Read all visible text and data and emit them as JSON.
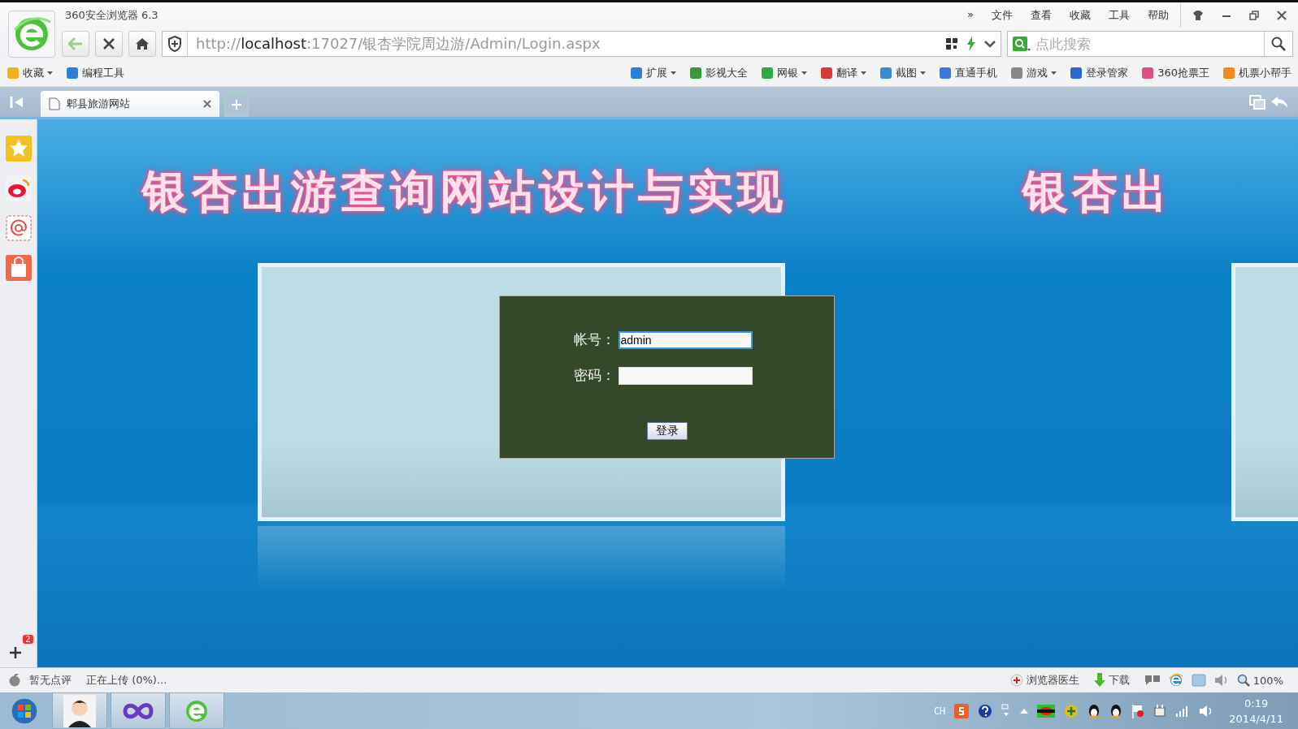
{
  "window": {
    "title": "360安全浏览器 6.3"
  },
  "menu": [
    "»",
    "文件",
    "查看",
    "收藏",
    "工具",
    "帮助"
  ],
  "address": {
    "scheme": "http://",
    "host": "localhost",
    "rest": ":17027/银杏学院周边游/Admin/Login.aspx"
  },
  "search": {
    "placeholder": "点此搜索"
  },
  "bookmarks_left": [
    {
      "label": "收藏",
      "dropdown": true
    },
    {
      "label": "编程工具",
      "dropdown": false
    }
  ],
  "bookmarks_right": [
    {
      "label": "扩展",
      "dropdown": true
    },
    {
      "label": "影视大全",
      "dropdown": false
    },
    {
      "label": "网银",
      "dropdown": true
    },
    {
      "label": "翻译",
      "dropdown": true
    },
    {
      "label": "截图",
      "dropdown": true
    },
    {
      "label": "直通手机",
      "dropdown": false
    },
    {
      "label": "游戏",
      "dropdown": true
    },
    {
      "label": "登录管家",
      "dropdown": false
    },
    {
      "label": "360抢票王",
      "dropdown": false
    },
    {
      "label": "机票小帮手",
      "dropdown": false
    }
  ],
  "tabs": [
    {
      "label": "郫县旅游网站",
      "selected": true
    }
  ],
  "sidebar": {
    "badge": "2"
  },
  "page": {
    "banner": [
      "银杏出游查询网站设计与实现",
      "银杏出"
    ],
    "login": {
      "fields": [
        {
          "label": "帐号：",
          "value": "admin"
        },
        {
          "label": "密码："
        }
      ],
      "button": "登录"
    }
  },
  "status_bar": {
    "left": [
      "暂无点评",
      "正在上传 (0%)..."
    ],
    "doctor": "浏览器医生",
    "download": "下载",
    "zoom": "100%"
  },
  "taskbar": {
    "lang": "CH",
    "time": "0:19",
    "date": "2014/4/11"
  }
}
